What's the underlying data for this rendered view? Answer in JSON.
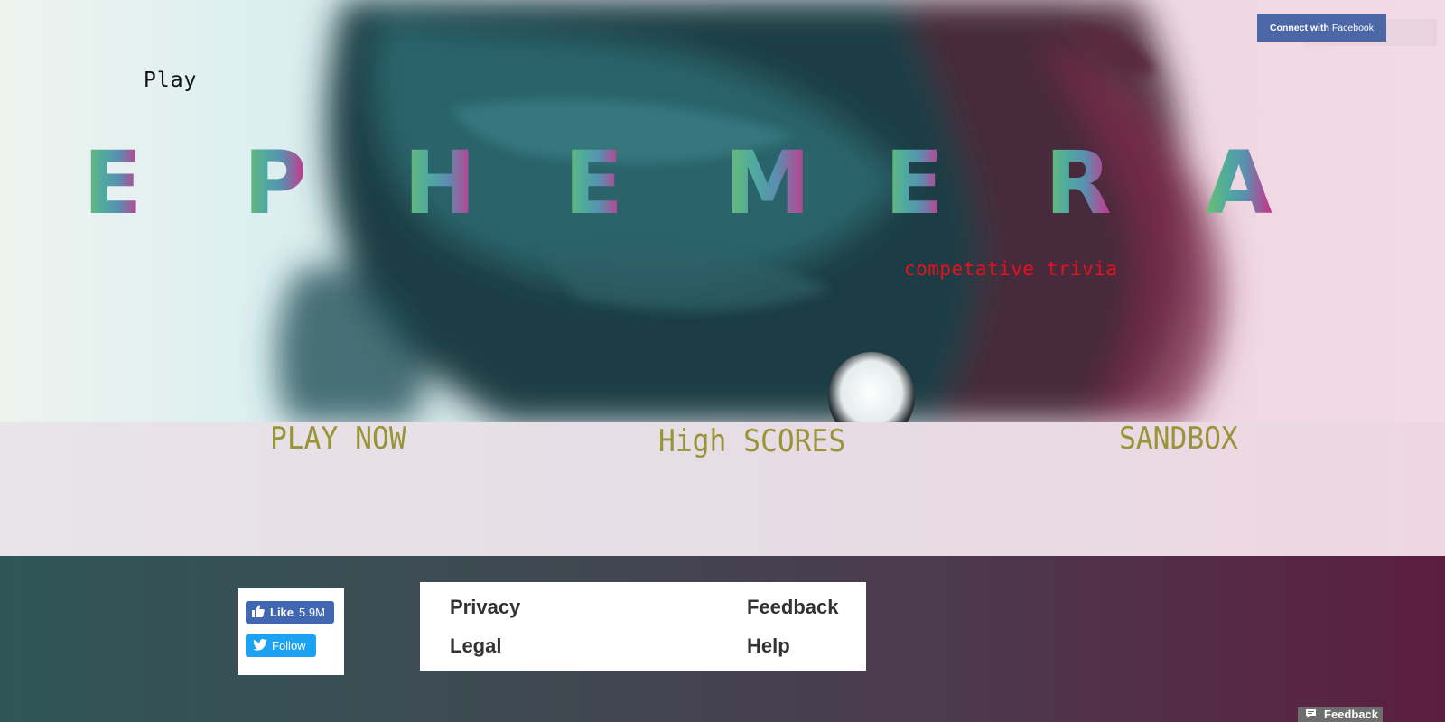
{
  "nav": {
    "play_label": "Play"
  },
  "logo": {
    "letters": [
      "E",
      "P",
      "H",
      "E",
      "M",
      "E",
      "R",
      "A"
    ]
  },
  "tagline": "competative trivia",
  "menu": {
    "play_now": "PLAY NOW",
    "high_scores": "High SCORES",
    "sandbox": "SANDBOX"
  },
  "facebook_connect": {
    "prefix": "Connect with",
    "brand": "Facebook"
  },
  "social": {
    "like_label": "Like",
    "like_count": "5.9M",
    "follow_label": "Follow"
  },
  "footer_links": {
    "privacy": "Privacy",
    "legal": "Legal",
    "feedback": "Feedback",
    "help": "Help"
  },
  "feedback_tab": "Feedback",
  "colors": {
    "tagline": "#e8101a",
    "menu": "#9a9438",
    "facebook": "#4c67a8",
    "twitter": "#1da1f2",
    "logo_gradient": [
      "#6cbf6e",
      "#4fa9a0",
      "#5a8fb0",
      "#9e5a9a",
      "#cc2e8a"
    ]
  },
  "icons": {
    "like": "thumbs-up-icon",
    "follow": "twitter-bird-icon",
    "feedback": "message-icon"
  }
}
